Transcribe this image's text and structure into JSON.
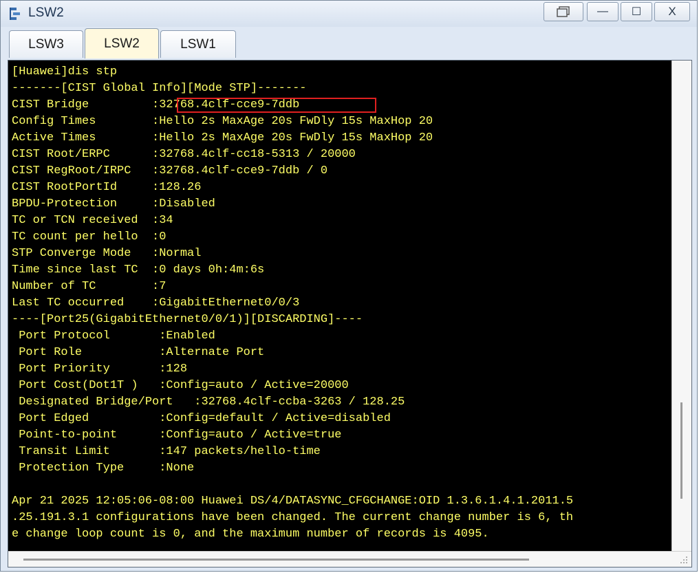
{
  "window": {
    "title": "LSW2",
    "colors": {
      "titlebar": "#dfe8f4",
      "terminal_bg": "#000000",
      "terminal_text": "#ffff66",
      "highlight": "#e02020",
      "active_tab": "#fff9de"
    }
  },
  "titlebar_buttons": [
    {
      "name": "restore",
      "icon": "restore-window-icon"
    },
    {
      "name": "minimize",
      "label": "—",
      "icon": "minimize-icon"
    },
    {
      "name": "maximize",
      "label": "☐",
      "icon": "maximize-icon"
    },
    {
      "name": "close",
      "label": "X",
      "icon": "close-icon"
    }
  ],
  "tabs": [
    {
      "label": "LSW3",
      "active": false
    },
    {
      "label": "LSW2",
      "active": true
    },
    {
      "label": "LSW1",
      "active": false
    }
  ],
  "terminal": {
    "lines": [
      "[Huawei]dis stp",
      "-------[CIST Global Info][Mode STP]-------",
      "CIST Bridge         :32768.4clf-cce9-7ddb",
      "Config Times        :Hello 2s MaxAge 20s FwDly 15s MaxHop 20",
      "Active Times        :Hello 2s MaxAge 20s FwDly 15s MaxHop 20",
      "CIST Root/ERPC      :32768.4clf-cc18-5313 / 20000",
      "CIST RegRoot/IRPC   :32768.4clf-cce9-7ddb / 0",
      "CIST RootPortId     :128.26",
      "BPDU-Protection     :Disabled",
      "TC or TCN received  :34",
      "TC count per hello  :0",
      "STP Converge Mode   :Normal",
      "Time since last TC  :0 days 0h:4m:6s",
      "Number of TC        :7",
      "Last TC occurred    :GigabitEthernet0/0/3",
      "----[Port25(GigabitEthernet0/0/1)][DISCARDING]----",
      " Port Protocol       :Enabled",
      " Port Role           :Alternate Port",
      " Port Priority       :128",
      " Port Cost(Dot1T )   :Config=auto / Active=20000",
      " Designated Bridge/Port   :32768.4clf-ccba-3263 / 128.25",
      " Port Edged          :Config=default / Active=disabled",
      " Point-to-point      :Config=auto / Active=true",
      " Transit Limit       :147 packets/hello-time",
      " Protection Type     :None",
      "",
      "Apr 21 2025 12:05:06-08:00 Huawei DS/4/DATASYNC_CFGCHANGE:OID 1.3.6.1.4.1.2011.5",
      ".25.191.3.1 configurations have been changed. The current change number is 6, th",
      "e change loop count is 0, and the maximum number of records is 4095."
    ]
  }
}
